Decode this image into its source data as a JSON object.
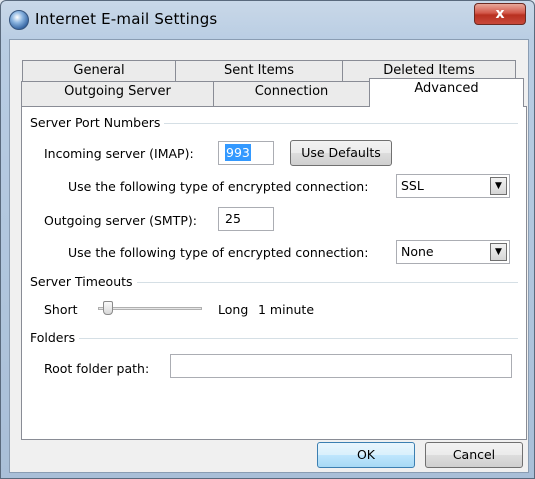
{
  "window": {
    "title": "Internet E-mail Settings",
    "close_label": "x"
  },
  "tabs": {
    "row1": [
      "General",
      "Sent Items",
      "Deleted Items"
    ],
    "row2": [
      "Outgoing Server",
      "Connection",
      "Advanced"
    ],
    "active": "Advanced"
  },
  "ports": {
    "section": "Server Port Numbers",
    "incoming_label": "Incoming server (IMAP):",
    "incoming_value": "993",
    "use_defaults": "Use Defaults",
    "incoming_enc_label": "Use the following type of encrypted connection:",
    "incoming_enc_value": "SSL",
    "outgoing_label": "Outgoing server (SMTP):",
    "outgoing_value": "25",
    "outgoing_enc_label": "Use the following type of encrypted connection:",
    "outgoing_enc_value": "None"
  },
  "timeouts": {
    "section": "Server Timeouts",
    "short_label": "Short",
    "long_label": "Long",
    "value_label": "1 minute",
    "level": 0.05
  },
  "folders": {
    "section": "Folders",
    "root_label": "Root folder path:",
    "root_value": ""
  },
  "buttons": {
    "ok": "OK",
    "cancel": "Cancel"
  }
}
